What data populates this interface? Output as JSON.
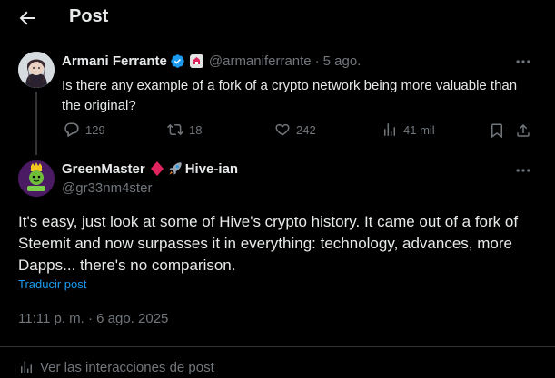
{
  "header": {
    "title": "Post"
  },
  "parent_post": {
    "author_name": "Armani Ferrante",
    "handle": "@armaniferrante",
    "separator": "·",
    "time": "5 ago.",
    "text": "Is there any example of a fork of a crypto network being more valuable than the original?",
    "stats": {
      "replies": "129",
      "reposts": "18",
      "likes": "242",
      "views": "41 mil"
    }
  },
  "reply_post": {
    "author_name": "GreenMaster",
    "author_name_suffix": "Hive-ian",
    "handle": "@gr33nm4ster",
    "text": "It's easy, just look at some of Hive's crypto history. It came out of a fork of Steemit and now surpasses it in everything: technology, advances, more Dapps... there's no comparison.",
    "translate_label": "Traducir post",
    "timestamp": "11:11 p. m. · 6 ago. 2025"
  },
  "footer": {
    "interactions_label": "Ver las interacciones de post"
  },
  "colors": {
    "background": "#000000",
    "text": "#e7e9ea",
    "muted": "#71767b",
    "accent": "#1d9bf0",
    "verified": "#1d9bf0",
    "diamond": "#e0245e"
  }
}
